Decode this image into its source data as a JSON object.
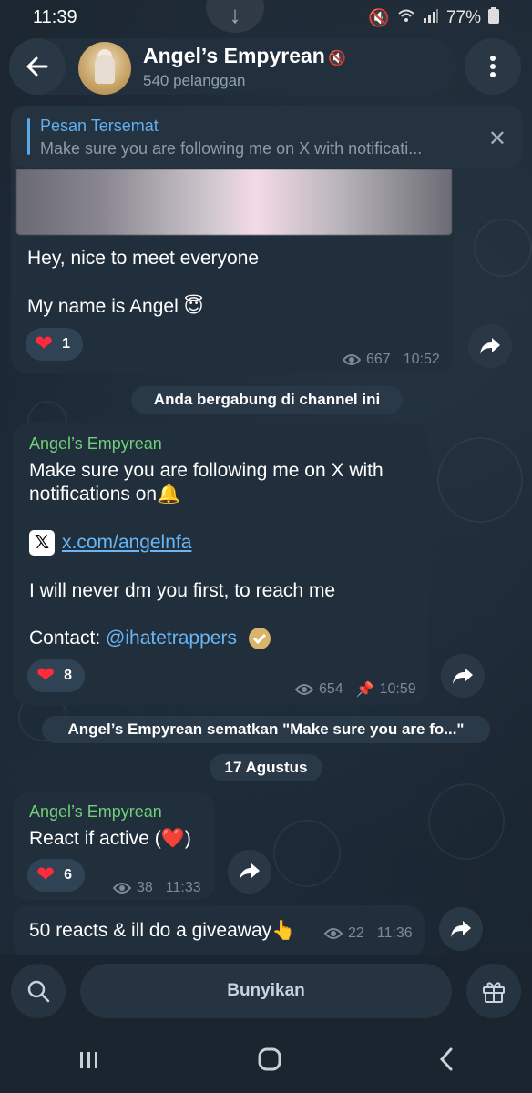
{
  "status_bar": {
    "time": "11:39",
    "battery": "77%"
  },
  "header": {
    "title": "Angel’s Empyrean",
    "subtitle": "540 pelanggan"
  },
  "pinned": {
    "label": "Pesan Tersemat",
    "text": "Make sure you are following me on X with notificati..."
  },
  "messages": [
    {
      "text_line1": "Hey, nice to meet everyone",
      "text_line2": "My name is Angel 😇",
      "reaction_count": "1",
      "views": "667",
      "time": "10:52"
    },
    {
      "sender": "Angel’s Empyrean",
      "text_line1": "Make sure you are following me on X with",
      "text_line2": "notifications on🔔",
      "link": "x.com/angelnfa",
      "text_line3": "I will never dm you first, to reach me",
      "contact_label": "Contact: ",
      "contact_mention": "@ihatetrappers",
      "reaction_count": "8",
      "views": "654",
      "time": "10:59"
    },
    {
      "sender": "Angel’s Empyrean",
      "text": "React if active (❤️)",
      "reaction_count": "6",
      "views": "38",
      "time": "11:33"
    },
    {
      "text": "50 reacts & ill do a giveaway👆",
      "views": "22",
      "time": "11:36"
    }
  ],
  "service": {
    "joined": "Anda bergabung di channel ini",
    "pinned_notice": "Angel’s Empyrean sematkan \"Make sure you are fo...\"",
    "date": "17 Agustus"
  },
  "bottom": {
    "unmute_label": "Bunyikan"
  },
  "icons": {
    "back": "arrow-left-icon",
    "menu": "more-vert-icon",
    "close": "close-icon",
    "share": "share-arrow-icon",
    "search": "search-icon",
    "gift": "gift-icon",
    "views": "eye-icon",
    "pin": "pin-icon",
    "mute": "muted-speaker-icon",
    "verified": "verified-badge-icon"
  },
  "colors": {
    "accent": "#5fb0f0",
    "sender": "#6fcf7a",
    "heart": "#ff2a3c"
  }
}
